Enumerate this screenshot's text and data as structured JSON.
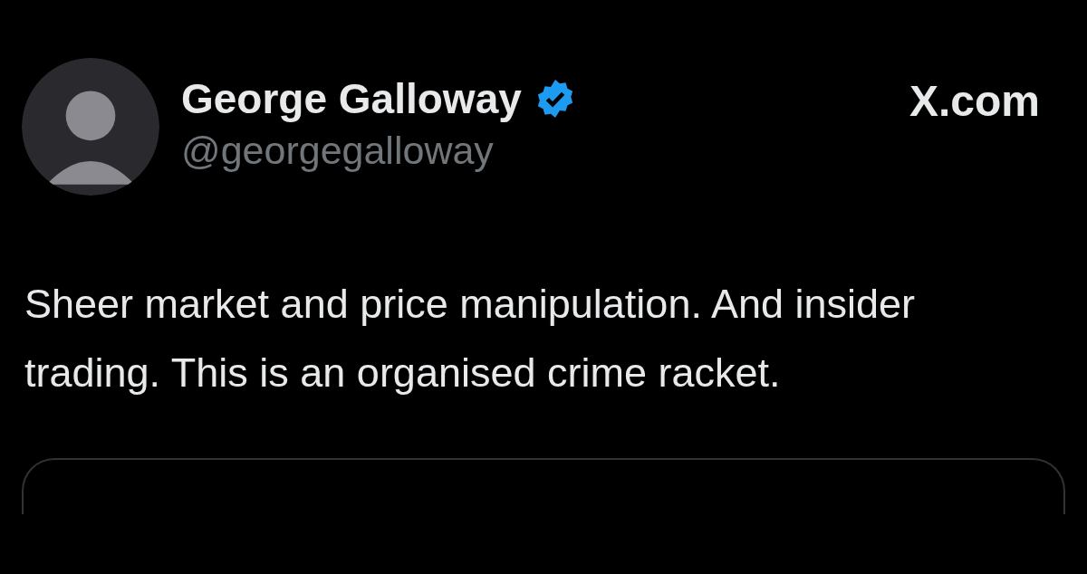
{
  "post": {
    "author": {
      "name": "George Galloway",
      "verified": true,
      "handle": "@georgegalloway"
    },
    "source": "X.com",
    "text": "Sheer market and price manipulation. And insider trading. This is an organised crime racket."
  }
}
